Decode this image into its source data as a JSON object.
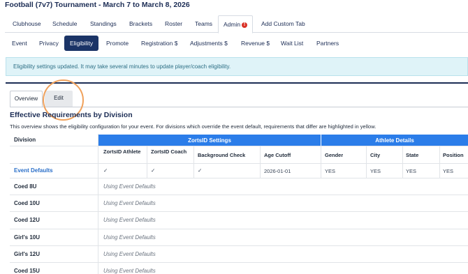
{
  "page_title": "Football (7v7) Tournament  -  March 7 to March 8, 2026",
  "main_tabs": [
    {
      "label": "Clubhouse",
      "active": false
    },
    {
      "label": "Schedule",
      "active": false
    },
    {
      "label": "Standings",
      "active": false
    },
    {
      "label": "Brackets",
      "active": false
    },
    {
      "label": "Roster",
      "active": false
    },
    {
      "label": "Admin",
      "active": true,
      "badge": "!"
    },
    {
      "label": "Add Custom Tab",
      "active": false
    }
  ],
  "admin_tabs": [
    {
      "label": "Event",
      "active": false
    },
    {
      "label": "Privacy",
      "active": false
    },
    {
      "label": "Eligibility",
      "active": true
    },
    {
      "label": "Promote",
      "active": false
    },
    {
      "label": "Registration $",
      "active": false
    },
    {
      "label": "Adjustments $",
      "active": false
    },
    {
      "label": "Revenue $",
      "active": false
    },
    {
      "label": "Wait List",
      "active": false
    },
    {
      "label": "Partners",
      "active": false
    }
  ],
  "alert_text": "Eligibility settings updated. It may take several minutes to update player/coach eligibility.",
  "sub_tabs": [
    {
      "label": "Overview",
      "active": true
    },
    {
      "label": "Edit",
      "active": false
    }
  ],
  "section_title": "Effective Requirements by Division",
  "description": "This overview shows the eligibility configuration for your event. For divisions which override the event default, requirements that differ are highlighted in yellow.",
  "table": {
    "division_header": "Division",
    "group_headers": [
      "ZortsID Settings",
      "Athlete Details"
    ],
    "columns": [
      "ZortsID Athlete",
      "ZortsID Coach",
      "Background Check",
      "Age Cutoff",
      "Gender",
      "City",
      "State",
      "Position"
    ],
    "defaults_row": {
      "label": "Event Defaults",
      "values": [
        "✓",
        "✓",
        "✓",
        "2026-01-01",
        "YES",
        "YES",
        "YES",
        "YES"
      ]
    },
    "using_defaults_text": "Using Event Defaults",
    "divisions": [
      "Coed 8U",
      "Coed 10U",
      "Coed 12U",
      "Girl's 10U",
      "Girl's 12U",
      "Coed 15U"
    ]
  },
  "colors": {
    "navy": "#1b3467",
    "group_header_blue": "#2b7de9",
    "alert_bg": "#dff3f8",
    "highlight_ring": "#f0a15b",
    "badge_red": "#d93025"
  }
}
